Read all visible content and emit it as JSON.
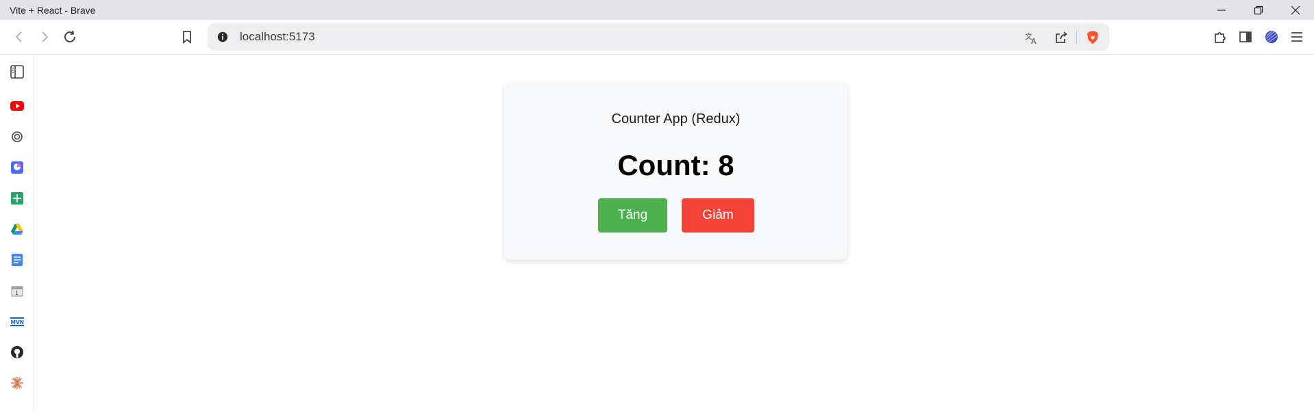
{
  "window": {
    "title": "Vite + React - Brave"
  },
  "toolbar": {
    "url": "localhost:5173"
  },
  "app": {
    "heading": "Counter App (Redux)",
    "count_label": "Count: 8",
    "increment_label": "Tăng",
    "decrement_label": "Giảm"
  },
  "colors": {
    "increment_button": "#4caf50",
    "decrement_button": "#f44336",
    "card_background": "#f7f8fa",
    "brave_orange": "#fb542b"
  },
  "sidebar": {
    "items": [
      "sidebar-panel-icon",
      "youtube-icon",
      "chatgpt-icon",
      "mixpanel-icon",
      "google-sheets-icon",
      "google-drive-icon",
      "google-docs-icon",
      "calendar-icon",
      "mvn-icon",
      "github-icon",
      "claude-icon"
    ]
  }
}
